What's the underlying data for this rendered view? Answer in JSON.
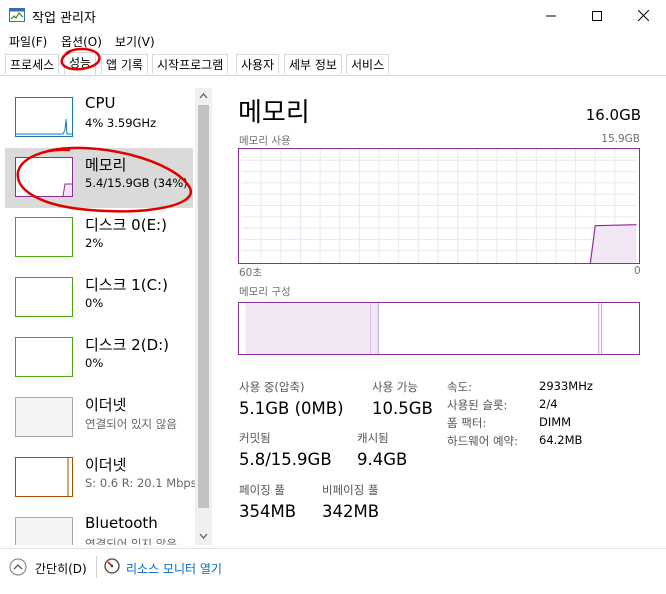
{
  "window": {
    "title": "작업 관리자",
    "controls": {
      "minimize": "—",
      "maximize": "☐",
      "close": "✕"
    }
  },
  "menu": [
    "파일(F)",
    "옵션(O)",
    "보기(V)"
  ],
  "tabs": [
    {
      "label": "프로세스",
      "active": false
    },
    {
      "label": "성능",
      "active": true
    },
    {
      "label": "앱 기록",
      "active": false
    },
    {
      "label": "시작프로그램",
      "active": false
    },
    {
      "label": "사용자",
      "active": false
    },
    {
      "label": "세부 정보",
      "active": false
    },
    {
      "label": "서비스",
      "active": false
    }
  ],
  "resources": [
    {
      "name": "CPU",
      "sub": "4% 3.59GHz",
      "color": "#1779ba"
    },
    {
      "name": "메모리",
      "sub": "5.4/15.9GB (34%)",
      "color": "#8b2c9a"
    },
    {
      "name": "디스크 0(E:)",
      "sub": "2%",
      "color": "#4da60c"
    },
    {
      "name": "디스크 1(C:)",
      "sub": "0%",
      "color": "#4da60c"
    },
    {
      "name": "디스크 2(D:)",
      "sub": "0%",
      "color": "#4da60c"
    },
    {
      "name": "이더넷",
      "sub": "연결되어 있지 않음",
      "color": "#a6a6a6"
    },
    {
      "name": "이더넷",
      "sub": "S: 0.6 R: 20.1 Mbps",
      "color": "#a74f01"
    },
    {
      "name": "Bluetooth",
      "sub": "연결되어 있지 않음",
      "color": "#a6a6a6"
    }
  ],
  "detail": {
    "title": "메모리",
    "total": "16.0GB",
    "usage_label": "메모리 사용",
    "usage_max": "15.9GB",
    "time_left": "60초",
    "time_right": "0",
    "composition_label": "메모리 구성",
    "stats": {
      "in_use_label": "사용 중(압축)",
      "in_use_value": "5.1GB (0MB)",
      "available_label": "사용 가능",
      "available_value": "10.5GB",
      "committed_label": "커밋됨",
      "committed_value": "5.8/15.9GB",
      "cached_label": "캐시됨",
      "cached_value": "9.4GB",
      "paged_label": "페이징 풀",
      "paged_value": "354MB",
      "nonpaged_label": "비페이징 풀",
      "nonpaged_value": "342MB"
    },
    "hardware": {
      "speed_label": "속도:",
      "speed_value": "2933MHz",
      "slots_label": "사용된 슬롯:",
      "slots_value": "2/4",
      "form_label": "폼 팩터:",
      "form_value": "DIMM",
      "reserved_label": "하드웨어 예약:",
      "reserved_value": "64.2MB"
    }
  },
  "footer": {
    "collapse_label": "간단히(D)",
    "monitor_label": "리소스 모니터 열기"
  },
  "colors": {
    "memory": "#8b2c9a",
    "cpu": "#1779ba",
    "disk": "#4da60c",
    "ethernet": "#a74f01",
    "link": "#0066cc"
  }
}
